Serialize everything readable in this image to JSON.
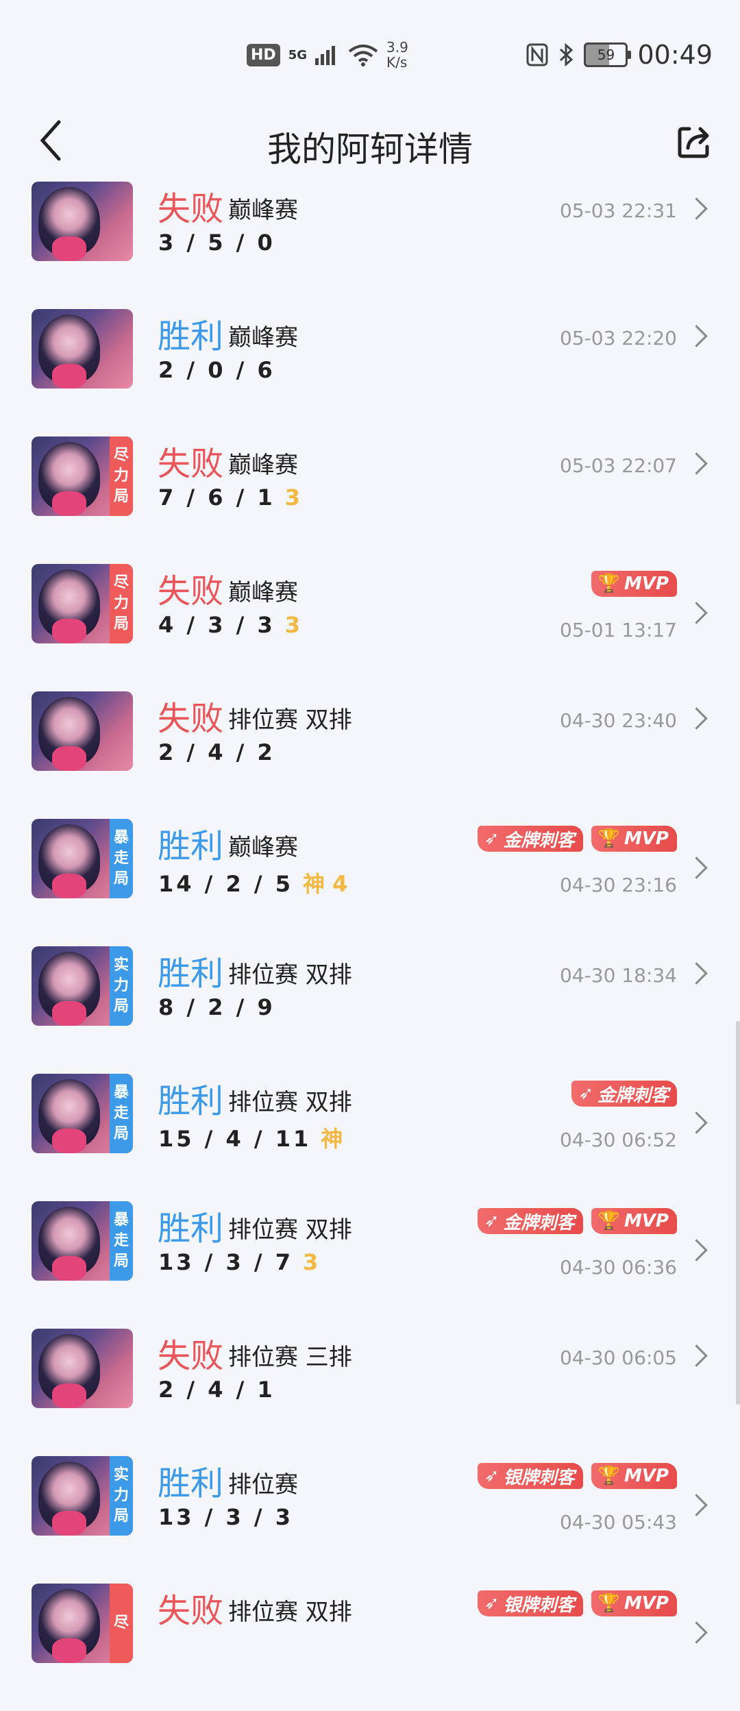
{
  "status_bar": {
    "hd": "HD",
    "signal": "5G",
    "speed_value": "3.9",
    "speed_unit": "K/s",
    "battery": "59",
    "time": "00:49"
  },
  "header": {
    "title": "我的阿轲详情"
  },
  "matches": [
    {
      "result": "失败",
      "type": "lose",
      "mode": "巅峰赛",
      "kda": "3 / 5 / 0",
      "extra": "",
      "tag": "",
      "tag_color": "",
      "badges": [],
      "time": "05-03 22:31"
    },
    {
      "result": "胜利",
      "type": "win",
      "mode": "巅峰赛",
      "kda": "2 / 0 / 6",
      "extra": "",
      "tag": "",
      "tag_color": "",
      "badges": [],
      "time": "05-03 22:20"
    },
    {
      "result": "失败",
      "type": "lose",
      "mode": "巅峰赛",
      "kda": "7 / 6 / 1",
      "extra": "3",
      "tag": "尽力局",
      "tag_color": "red",
      "badges": [],
      "time": "05-03 22:07"
    },
    {
      "result": "失败",
      "type": "lose",
      "mode": "巅峰赛",
      "kda": "4 / 3 / 3",
      "extra": "3",
      "tag": "尽力局",
      "tag_color": "red",
      "badges": [
        "MVP"
      ],
      "time": "05-01 13:17"
    },
    {
      "result": "失败",
      "type": "lose",
      "mode": "排位赛 双排",
      "kda": "2 / 4 / 2",
      "extra": "",
      "tag": "",
      "tag_color": "",
      "badges": [],
      "time": "04-30 23:40"
    },
    {
      "result": "胜利",
      "type": "win",
      "mode": "巅峰赛",
      "kda": "14 / 2 / 5",
      "extra": "神 4",
      "tag": "暴走局",
      "tag_color": "blue",
      "badges": [
        "金牌刺客",
        "MVP"
      ],
      "time": "04-30 23:16"
    },
    {
      "result": "胜利",
      "type": "win",
      "mode": "排位赛 双排",
      "kda": "8 / 2 / 9",
      "extra": "",
      "tag": "实力局",
      "tag_color": "blue",
      "badges": [],
      "time": "04-30 18:34"
    },
    {
      "result": "胜利",
      "type": "win",
      "mode": "排位赛 双排",
      "kda": "15 / 4 / 11",
      "extra": "神",
      "tag": "暴走局",
      "tag_color": "blue",
      "badges": [
        "金牌刺客"
      ],
      "time": "04-30 06:52"
    },
    {
      "result": "胜利",
      "type": "win",
      "mode": "排位赛 双排",
      "kda": "13 / 3 / 7",
      "extra": "3",
      "tag": "暴走局",
      "tag_color": "blue",
      "badges": [
        "金牌刺客",
        "MVP"
      ],
      "time": "04-30 06:36"
    },
    {
      "result": "失败",
      "type": "lose",
      "mode": "排位赛 三排",
      "kda": "2 / 4 / 1",
      "extra": "",
      "tag": "",
      "tag_color": "",
      "badges": [],
      "time": "04-30 06:05"
    },
    {
      "result": "胜利",
      "type": "win",
      "mode": "排位赛",
      "kda": "13 / 3 / 3",
      "extra": "",
      "tag": "实力局",
      "tag_color": "blue",
      "badges": [
        "银牌刺客",
        "MVP"
      ],
      "time": "04-30 05:43"
    },
    {
      "result": "失败",
      "type": "lose",
      "mode": "排位赛 双排",
      "kda": "",
      "extra": "",
      "tag": "尽",
      "tag_color": "red",
      "badges": [
        "银牌刺客",
        "MVP"
      ],
      "time": ""
    }
  ],
  "colors": {
    "win": "#3d9ae8",
    "lose": "#e8565a",
    "extra": "#f4b845",
    "badge": "#e74b4b"
  }
}
